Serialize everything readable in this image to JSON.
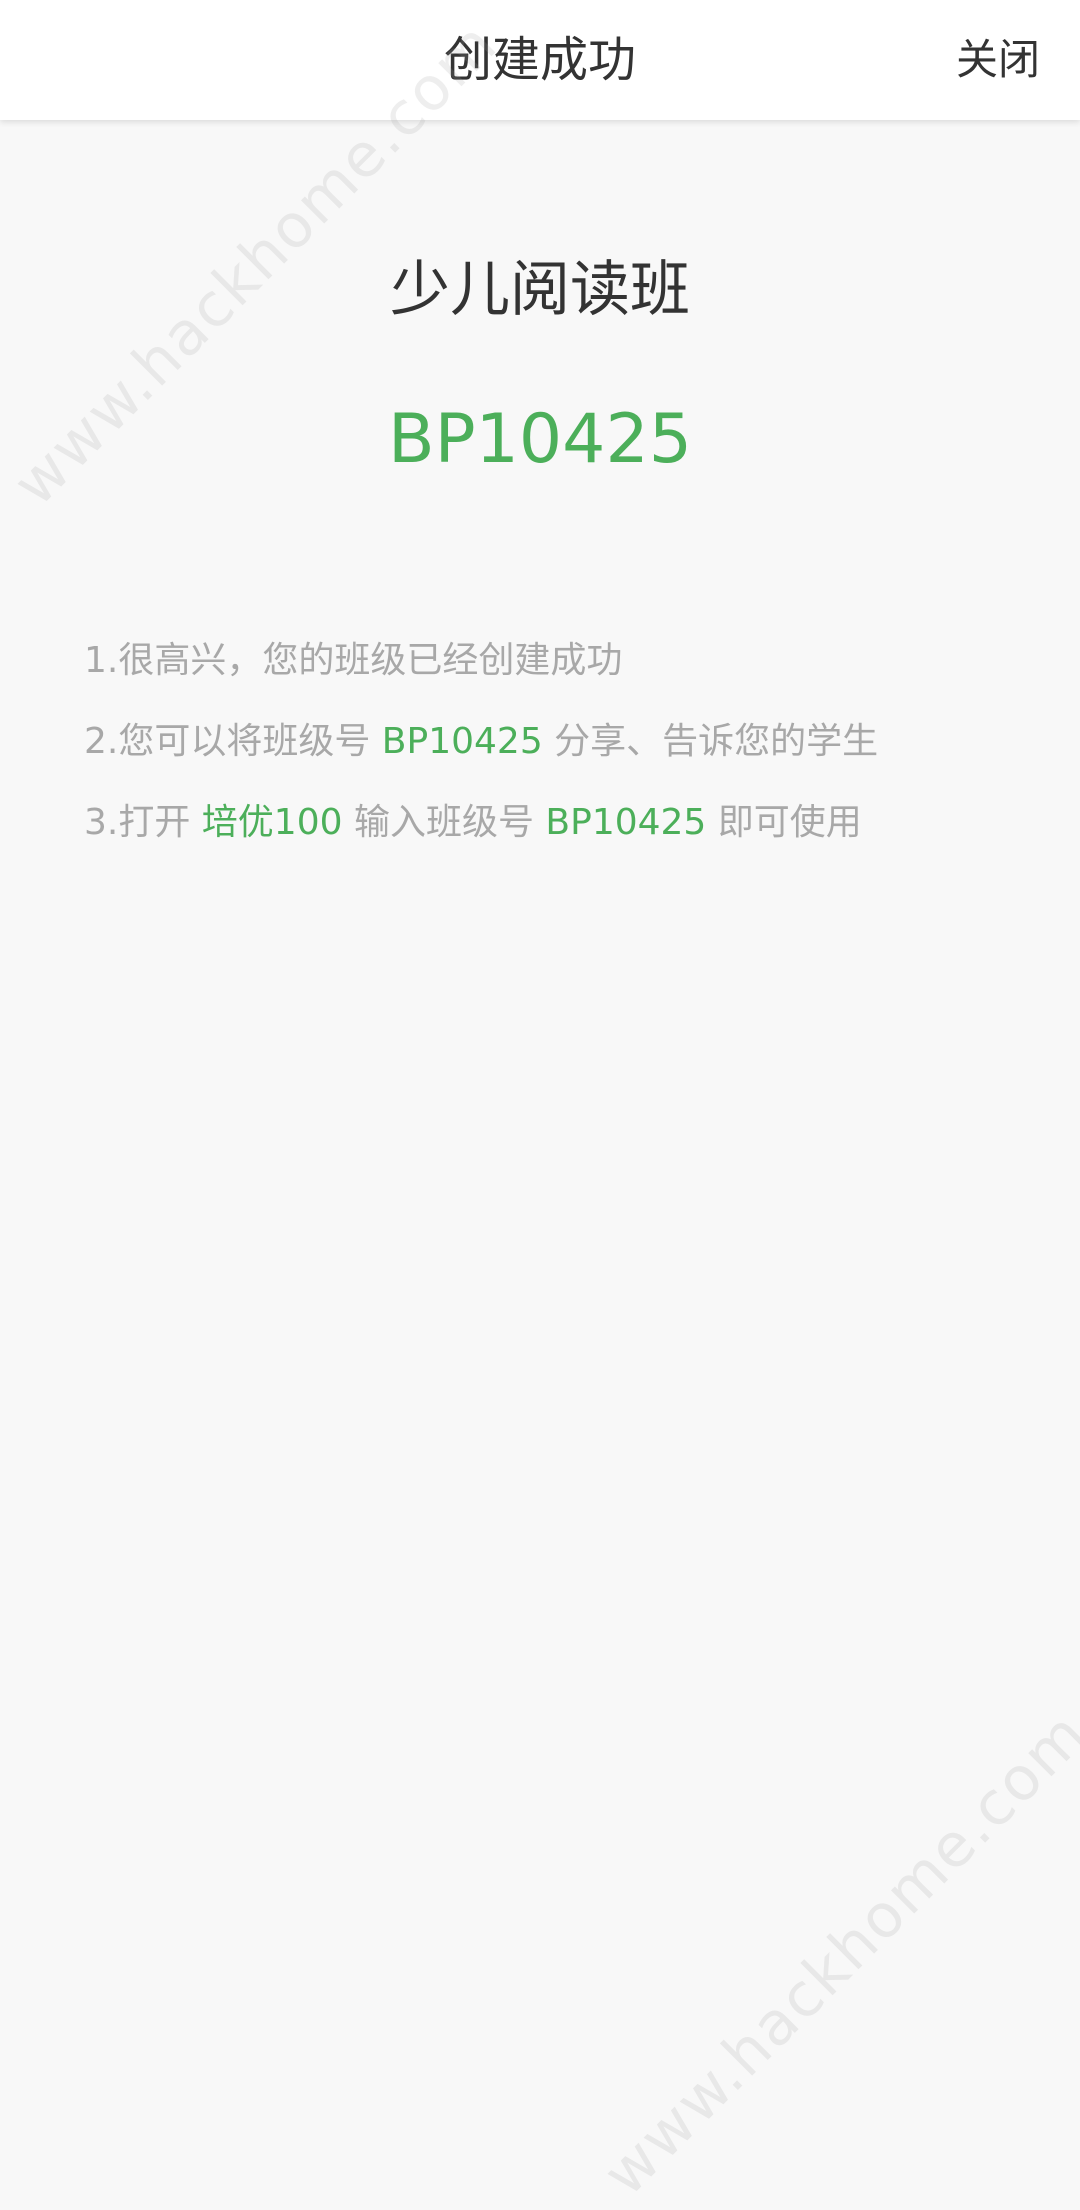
{
  "header": {
    "title": "创建成功",
    "close_label": "关闭"
  },
  "class_info": {
    "name": "少儿阅读班",
    "code": "BP10425"
  },
  "instructions": {
    "line1": "1.很高兴，您的班级已经创建成功",
    "line2_prefix": "2.您可以将班级号 ",
    "line2_code": "BP10425",
    "line2_suffix": " 分享、告诉您的学生",
    "line3_prefix": "3.打开 ",
    "line3_app": "培优100",
    "line3_middle": " 输入班级号 ",
    "line3_code": "BP10425",
    "line3_suffix": " 即可使用"
  },
  "watermark": "www.hackhome.com",
  "colors": {
    "accent": "#4caf5a",
    "background": "#f8f8f8",
    "header_bg": "#ffffff",
    "muted_text": "#a8a8a8",
    "dark_text": "#333333"
  }
}
